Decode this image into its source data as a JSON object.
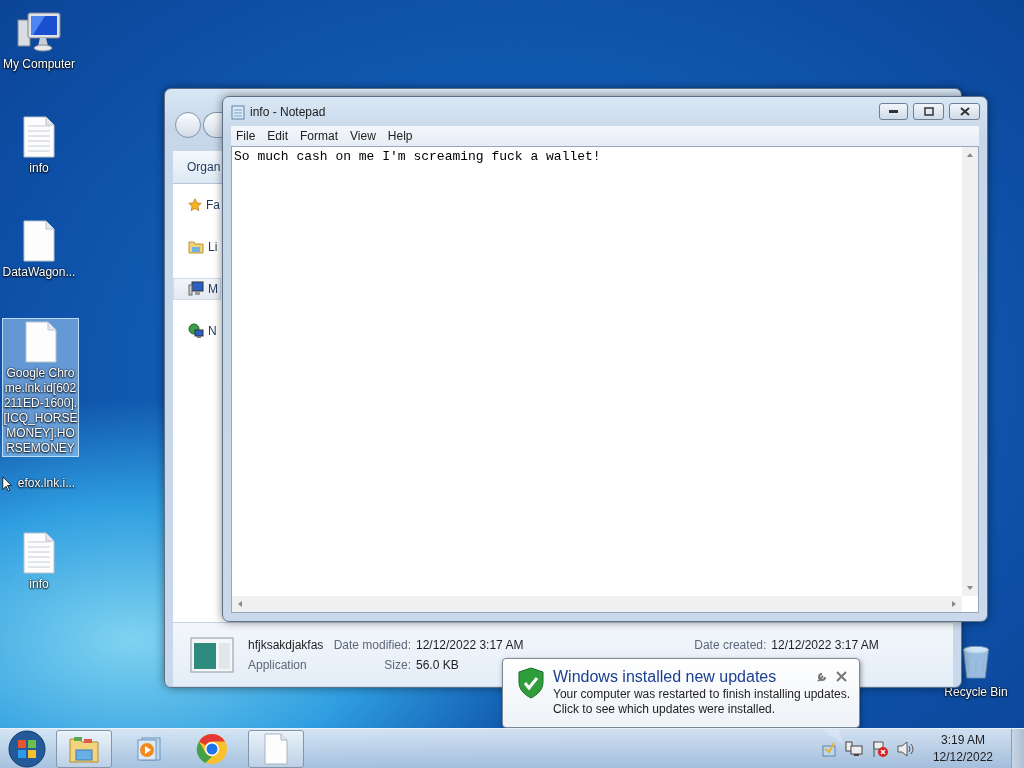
{
  "desktop_icons": [
    {
      "kind": "computer",
      "label": "My Computer",
      "selected": false
    },
    {
      "kind": "text",
      "label": "info",
      "selected": false
    },
    {
      "kind": "blank",
      "label": "DataWagon...",
      "selected": false
    },
    {
      "kind": "blank",
      "label": "Google Chrome.lnk.id[602211ED-1600].[ICQ_HORSEMONEY].HORSEMONEY",
      "selected": true
    },
    {
      "kind": "label",
      "label": "efox.lnk.i...",
      "selected": false
    },
    {
      "kind": "text",
      "label": "info",
      "selected": false
    },
    {
      "kind": "recycle",
      "label": "Recycle Bin",
      "selected": false
    }
  ],
  "explorer": {
    "toolbar_item": "Organ",
    "nav_pane": [
      {
        "kind": "favorites",
        "label": "Fa",
        "selected": false
      },
      {
        "kind": "libraries",
        "label": "Li",
        "selected": false
      },
      {
        "kind": "computer",
        "label": "M",
        "selected": true
      },
      {
        "kind": "network",
        "label": "N",
        "selected": false
      }
    ],
    "details": {
      "name": "hfjksakdjakfas",
      "type": "Application",
      "fields": [
        {
          "label": "Date modified:",
          "value": "12/12/2022 3:17 AM"
        },
        {
          "label": "Size:",
          "value": "56.0 KB"
        },
        {
          "label": "Date created:",
          "value": "12/12/2022 3:17 AM"
        }
      ]
    }
  },
  "notepad": {
    "title": "info - Notepad",
    "menu": [
      "File",
      "Edit",
      "Format",
      "View",
      "Help"
    ],
    "text": "So much cash on me I'm screaming fuck a wallet!"
  },
  "notification": {
    "title": "Windows installed new updates",
    "lines": [
      "Your computer was restarted to finish installing updates.",
      "Click to see which updates were installed."
    ]
  },
  "taskbar": {
    "buttons": [
      {
        "kind": "explorer",
        "running": true
      },
      {
        "kind": "media",
        "running": false
      },
      {
        "kind": "chrome",
        "running": false
      },
      {
        "kind": "notepad",
        "running": true
      }
    ],
    "time": "3:19 AM",
    "date": "12/12/2022"
  }
}
